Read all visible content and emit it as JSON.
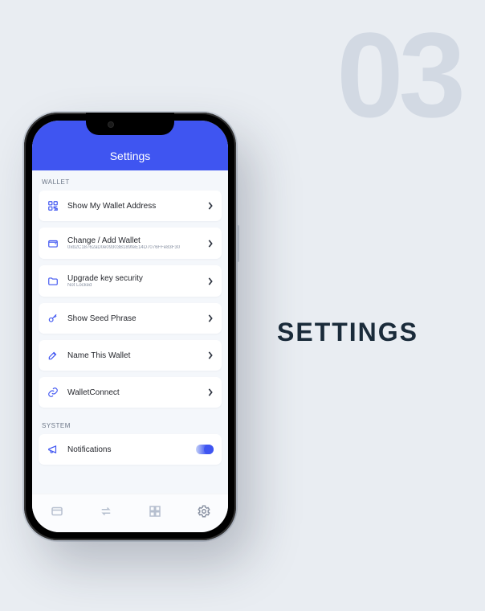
{
  "slide": {
    "number": "03",
    "title": "SETTINGS"
  },
  "header": {
    "title": "Settings"
  },
  "sections": {
    "wallet": {
      "label": "WALLET"
    },
    "system": {
      "label": "SYSTEM"
    }
  },
  "rows": {
    "show_address": {
      "title": "Show My Wallet Address"
    },
    "change_wallet": {
      "title": "Change / Add Wallet",
      "sub": "0xb2C18762aD0e09303B189feE14D7076FFe83F30"
    },
    "upgrade_security": {
      "title": "Upgrade key security",
      "sub": "Not Locked"
    },
    "seed_phrase": {
      "title": "Show Seed Phrase"
    },
    "name_wallet": {
      "title": "Name This Wallet"
    },
    "walletconnect": {
      "title": "WalletConnect"
    },
    "notifications": {
      "title": "Notifications",
      "enabled": true
    }
  },
  "colors": {
    "accent": "#3f55f1",
    "background": "#e9edf2",
    "card": "#ffffff"
  }
}
